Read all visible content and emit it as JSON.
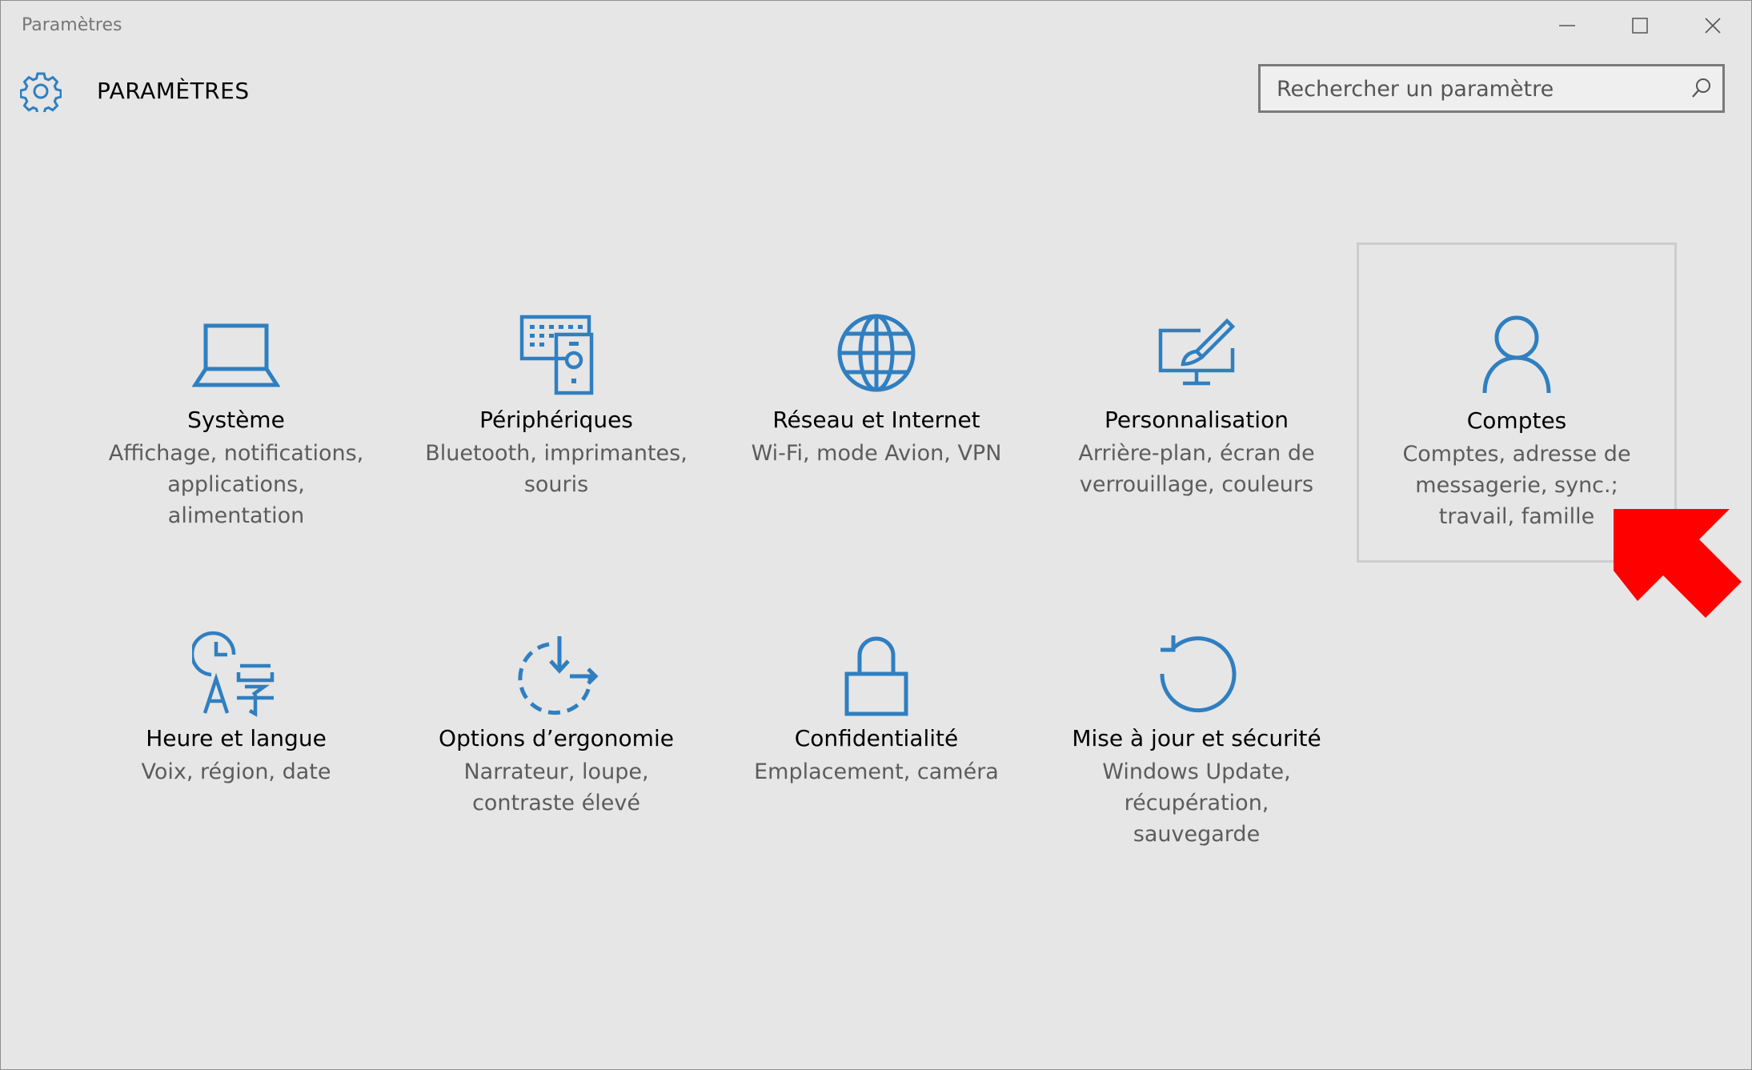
{
  "window": {
    "title": "Paramètres"
  },
  "header": {
    "title": "PARAMÈTRES",
    "gear_icon": "gear-icon"
  },
  "search": {
    "placeholder": "Rechercher un paramètre",
    "icon": "search-icon"
  },
  "colors": {
    "accent": "#2f7fc1",
    "background": "#e6e6e6",
    "description_text": "#5c5c5c",
    "annotation_arrow": "#ff0000"
  },
  "tiles": [
    {
      "name": "Système",
      "desc_lines": [
        "Affichage, notifications,",
        "applications,",
        "alimentation"
      ],
      "icon": "laptop-icon"
    },
    {
      "name": "Périphériques",
      "desc_lines": [
        "Bluetooth, imprimantes,",
        "souris"
      ],
      "icon": "devices-icon"
    },
    {
      "name": "Réseau et Internet",
      "desc_lines": [
        "Wi-Fi, mode Avion, VPN"
      ],
      "icon": "globe-icon"
    },
    {
      "name": "Personnalisation",
      "desc_lines": [
        "Arrière-plan, écran de",
        "verrouillage, couleurs"
      ],
      "icon": "paint-monitor-icon"
    },
    {
      "name": "Comptes",
      "desc_lines": [
        "Comptes, adresse de",
        "messagerie, sync.;",
        "travail, famille"
      ],
      "icon": "person-icon",
      "selected": true
    },
    {
      "name": "Heure et langue",
      "desc_lines": [
        "Voix, région, date"
      ],
      "icon": "time-language-icon"
    },
    {
      "name": "Options d’ergonomie",
      "desc_lines": [
        "Narrateur, loupe,",
        "contraste élevé"
      ],
      "icon": "ease-of-access-icon"
    },
    {
      "name": "Confidentialité",
      "desc_lines": [
        "Emplacement, caméra"
      ],
      "icon": "lock-icon"
    },
    {
      "name": "Mise à jour et sécurité",
      "desc_lines": [
        "Windows Update,",
        "récupération,",
        "sauvegarde"
      ],
      "icon": "update-icon"
    }
  ]
}
